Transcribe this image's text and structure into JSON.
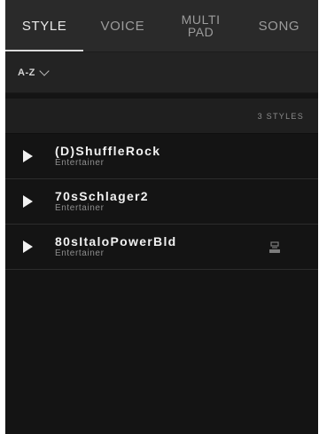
{
  "tabs": [
    {
      "label": "STYLE",
      "active": true
    },
    {
      "label": "VOICE",
      "active": false
    },
    {
      "line1": "MULTI",
      "line2": "PAD",
      "active": false
    },
    {
      "label": "SONG",
      "active": false
    }
  ],
  "sort": {
    "label": "A-Z",
    "icon": "chevron-down-icon"
  },
  "count_label": "3 STYLES",
  "items": [
    {
      "name": "(D)ShuffleRock",
      "category": "Entertainer",
      "has_storage_icon": false
    },
    {
      "name": "70sSchlager2",
      "category": "Entertainer",
      "has_storage_icon": false
    },
    {
      "name": "80sItaloPowerBld",
      "category": "Entertainer",
      "has_storage_icon": true
    }
  ],
  "colors": {
    "panel_bg": "#141414",
    "tab_bg": "#2a2a2a",
    "active_text": "#eaeaea",
    "inactive_text": "#9c9c9c"
  }
}
